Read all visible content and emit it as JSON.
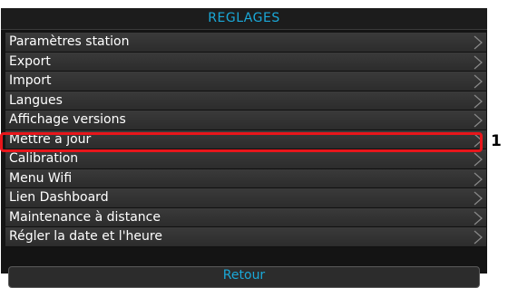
{
  "header": {
    "title": "REGLAGES"
  },
  "menu": {
    "items": [
      {
        "label": "Paramètres station"
      },
      {
        "label": "Export"
      },
      {
        "label": "Import"
      },
      {
        "label": "Langues"
      },
      {
        "label": "Affichage versions"
      },
      {
        "label": "Mettre à jour"
      },
      {
        "label": "Calibration"
      },
      {
        "label": "Menu Wifi"
      },
      {
        "label": "Lien Dashboard"
      },
      {
        "label": "Maintenance à distance"
      },
      {
        "label": "Régler la date et l'heure"
      }
    ]
  },
  "annotation": {
    "callout_number": "1",
    "highlighted_item": "Mettre à jour"
  },
  "footer": {
    "back_label": "Retour"
  },
  "colors": {
    "accent": "#1aa8d8",
    "highlight": "#e8161b",
    "background": "#141414",
    "item_background": "#333333"
  }
}
